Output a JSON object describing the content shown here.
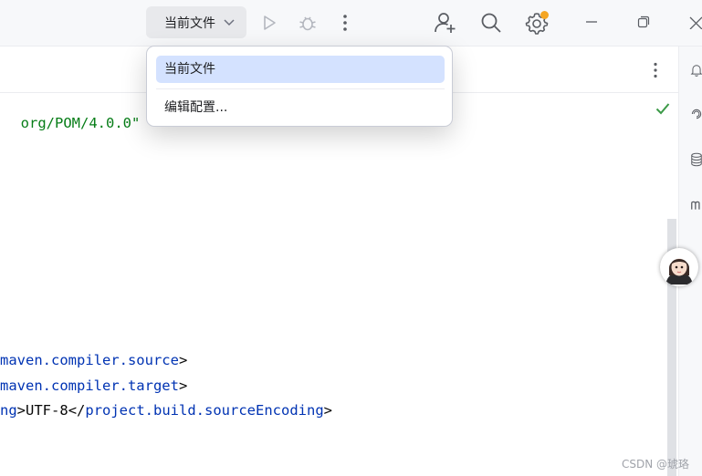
{
  "toolbar": {
    "run_config_label": "当前文件",
    "icons": [
      "chevron-down-icon",
      "run-icon",
      "debug-icon",
      "more-vertical-icon",
      "add-user-icon",
      "search-icon",
      "settings-icon",
      "minimize-icon",
      "restore-icon",
      "close-icon"
    ],
    "settings_badge_color": "#f5a623"
  },
  "dropdown": {
    "items": [
      {
        "label": "当前文件",
        "selected": true
      },
      {
        "label": "编辑配置..."
      }
    ]
  },
  "editor": {
    "lines": {
      "namespace_tail": "org/POM/4.0.0\"",
      "source_open": "maven.compiler.source",
      "target_open": "maven.compiler.target",
      "encoding_prefix": "ng",
      "encoding_value": "UTF-8",
      "encoding_close": "project.build.sourceEncoding"
    },
    "inspection_status": "ok"
  },
  "watermark": "CSDN @琥珞",
  "colors": {
    "tag": "#0033b3",
    "string": "#067d17",
    "selection": "#d4e2ff",
    "check": "#3c9a48"
  }
}
